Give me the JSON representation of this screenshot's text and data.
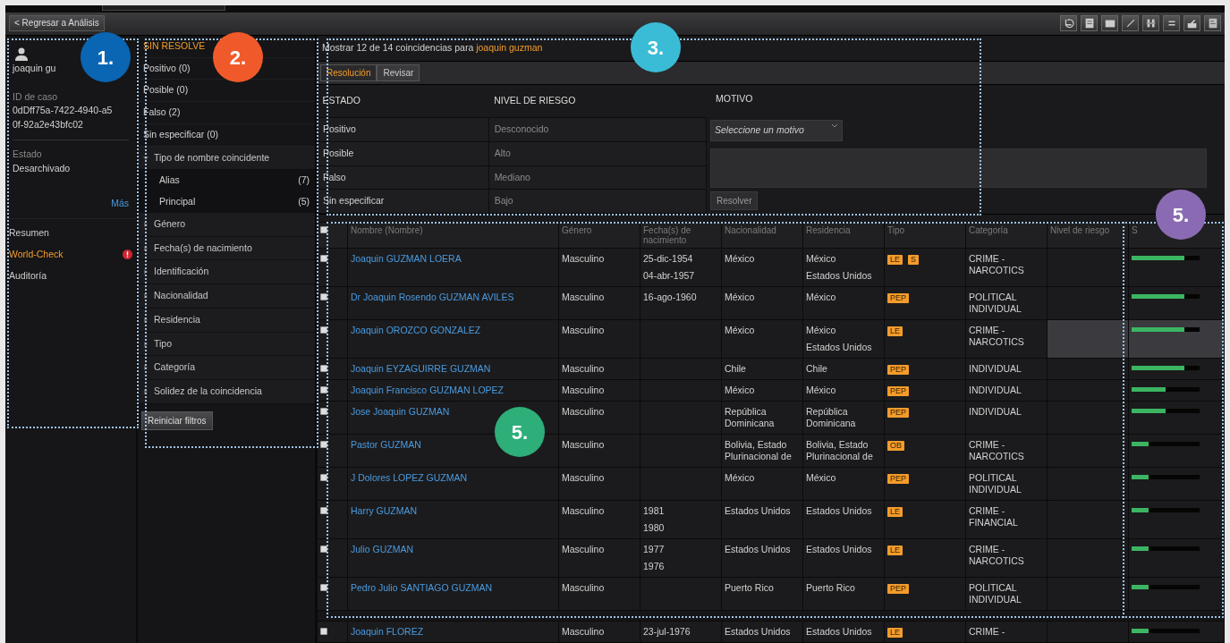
{
  "toolbar": {
    "back_button": "< Regresar a Análisis"
  },
  "profile": {
    "name": "joaquin gu",
    "case_id_label": "ID de caso",
    "case_id": "0dDff75a-7422-4940-a50f-92a2e43bfc02",
    "status_label": "Estado",
    "status": "Desarchivado",
    "more_link": "Más"
  },
  "nav": [
    {
      "label": "Resumen",
      "selected": false,
      "alert": false
    },
    {
      "label": "World-Check",
      "selected": true,
      "alert": true
    },
    {
      "label": "Auditoría",
      "selected": false,
      "alert": false
    }
  ],
  "filters": {
    "heading": "SIN RESOLVE",
    "status_items": [
      "Positivo (0)",
      "Posible (0)",
      "Falso (2)",
      "Sin especificar (0)"
    ],
    "groups": [
      {
        "label": "Tipo de nombre coincidente",
        "expanded": true,
        "children": [
          {
            "label": "Alias",
            "count": "(7)"
          },
          {
            "label": "Principal",
            "count": "(5)"
          }
        ]
      },
      {
        "label": "Género",
        "expanded": false
      },
      {
        "label": "Fecha(s) de nacimiento",
        "expanded": false
      },
      {
        "label": "Identificación",
        "expanded": false
      },
      {
        "label": "Nacionalidad",
        "expanded": false
      },
      {
        "label": "Residencia",
        "expanded": false
      },
      {
        "label": "Tipo",
        "expanded": false
      },
      {
        "label": "Categoría",
        "expanded": false
      },
      {
        "label": "Solidez de la coincidencia",
        "expanded": false
      }
    ],
    "reset_button": "Reiniciar filtros"
  },
  "summary": {
    "text": "Mostrar 12 de 14 coincidencias para",
    "query": "joaquin guzman"
  },
  "resolution": {
    "tabs": [
      {
        "label": "Resolución",
        "selected": true
      },
      {
        "label": "Revisar",
        "selected": false
      }
    ],
    "columns": [
      "ESTADO",
      "NIVEL DE RIESGO",
      "MOTIVO"
    ],
    "status_options": [
      "Positivo",
      "Posible",
      "Falso",
      "Sin especificar"
    ],
    "risk_options": [
      "Desconocido",
      "Alto",
      "Mediano",
      "Bajo"
    ],
    "reason_select": "Seleccione un motivo",
    "resolve_button": "Resolver"
  },
  "results": {
    "select_all_checked": false,
    "columns": [
      "Nombre (Nombre)",
      "Género",
      "Fecha(s) de nacimiento",
      "Nacionalidad",
      "Residencia",
      "Tipo",
      "Categoría",
      "Nivel de riesgo",
      "S"
    ],
    "rows": [
      {
        "checked": false,
        "name": "Joaquin GUZMAN LOERA",
        "gender": "Masculino",
        "dates": [
          "25-dic-1954",
          "04-abr-1957"
        ],
        "nationality": "México",
        "residence": [
          "México",
          "Estados Unidos"
        ],
        "types": [
          "LE",
          "S"
        ],
        "category": "CRIME - NARCOTICS",
        "level": 0.78,
        "highlighted": false
      },
      {
        "checked": false,
        "name": "Dr Joaquin Rosendo GUZMAN AVILES",
        "gender": "Masculino",
        "dates": [
          "16-ago-1960"
        ],
        "nationality": "México",
        "residence": [
          "México"
        ],
        "types": [
          "PEP"
        ],
        "category": "POLITICAL INDIVIDUAL",
        "level": 0.78,
        "highlighted": false
      },
      {
        "checked": false,
        "name": "Joaquin OROZCO GONZALEZ",
        "gender": "Masculino",
        "dates": [],
        "nationality": "México",
        "residence": [
          "México",
          "Estados Unidos"
        ],
        "types": [
          "LE"
        ],
        "category": "CRIME - NARCOTICS",
        "level": 0.78,
        "highlighted": true
      },
      {
        "checked": false,
        "name": "Joaquin EYZAGUIRRE GUZMAN",
        "gender": "Masculino",
        "dates": [],
        "nationality": "Chile",
        "residence": [
          "Chile"
        ],
        "types": [
          "PEP"
        ],
        "category": "INDIVIDUAL",
        "level": 0.78,
        "highlighted": false
      },
      {
        "checked": false,
        "name": "Joaquin Francisco GUZMAN LOPEZ",
        "gender": "Masculino",
        "dates": [],
        "nationality": "México",
        "residence": [
          "México"
        ],
        "types": [
          "PEP"
        ],
        "category": "INDIVIDUAL",
        "level": 0.5,
        "highlighted": false
      },
      {
        "checked": false,
        "name": "Jose Joaquin GUZMAN",
        "gender": "Masculino",
        "dates": [],
        "nationality": "República Dominicana",
        "residence": [
          "República Dominicana"
        ],
        "types": [
          "PEP"
        ],
        "category": "INDIVIDUAL",
        "level": 0.5,
        "highlighted": false
      },
      {
        "checked": false,
        "name": "Pastor GUZMAN",
        "gender": "Masculino",
        "dates": [],
        "nationality": "Bolivia, Estado Plurinacional de",
        "residence": [
          "Bolivia, Estado Plurinacional de"
        ],
        "types": [
          "OB"
        ],
        "category": "CRIME - NARCOTICS",
        "level": 0.25,
        "highlighted": false
      },
      {
        "checked": false,
        "name": "J Dolores LOPEZ GUZMAN",
        "gender": "Masculino",
        "dates": [],
        "nationality": "México",
        "residence": [
          "México"
        ],
        "types": [
          "PEP"
        ],
        "category": "POLITICAL INDIVIDUAL",
        "level": 0.25,
        "highlighted": false
      },
      {
        "checked": false,
        "name": "Harry GUZMAN",
        "gender": "Masculino",
        "dates": [
          "1981",
          "1980"
        ],
        "nationality": "Estados Unidos",
        "residence": [
          "Estados Unidos"
        ],
        "types": [
          "LE"
        ],
        "category": "CRIME - FINANCIAL",
        "level": 0.25,
        "highlighted": false
      },
      {
        "checked": false,
        "name": "Julio GUZMAN",
        "gender": "Masculino",
        "dates": [
          "1977",
          "1976"
        ],
        "nationality": "Estados Unidos",
        "residence": [
          "Estados Unidos"
        ],
        "types": [
          "LE"
        ],
        "category": "CRIME - NARCOTICS",
        "level": 0.25,
        "highlighted": false
      },
      {
        "checked": false,
        "name": "Pedro Julio SANTIAGO GUZMAN",
        "gender": "Masculino",
        "dates": [],
        "nationality": "Puerto Rico",
        "residence": [
          "Puerto Rico"
        ],
        "types": [
          "PEP"
        ],
        "category": "POLITICAL INDIVIDUAL",
        "level": 0.25,
        "highlighted": false
      },
      {
        "checked": false,
        "name": "Joaquin FLOREZ",
        "gender": "Masculino",
        "dates": [
          "23-jul-1976"
        ],
        "nationality": "Estados Unidos",
        "residence": [
          "Estados Unidos"
        ],
        "types": [
          "LE"
        ],
        "category": "CRIME -",
        "level": 0.25,
        "highlighted": false
      }
    ]
  },
  "callouts": [
    {
      "label": "1.",
      "color": "#0a65b3"
    },
    {
      "label": "2.",
      "color": "#f05a2a"
    },
    {
      "label": "3.",
      "color": "#3bbcd6"
    },
    {
      "label": "5.",
      "color": "#8a6bb3"
    },
    {
      "label": "5.",
      "color": "#2eae78"
    }
  ]
}
